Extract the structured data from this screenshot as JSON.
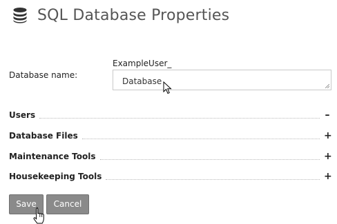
{
  "header": {
    "title": "SQL Database Properties",
    "icon": "database-icon"
  },
  "db_name": {
    "label": "Database name:",
    "prefix": "ExampleUser_",
    "value": "Database"
  },
  "sections": [
    {
      "title": "Users",
      "toggle": "–",
      "state": "expanded"
    },
    {
      "title": "Database Files",
      "toggle": "+",
      "state": "collapsed"
    },
    {
      "title": "Maintenance Tools",
      "toggle": "+",
      "state": "collapsed"
    },
    {
      "title": "Housekeeping Tools",
      "toggle": "+",
      "state": "collapsed"
    }
  ],
  "actions": {
    "save_label": "Save",
    "cancel_label": "Cancel"
  },
  "colors": {
    "button_bg": "#8a8a8a",
    "title_text": "#555555"
  }
}
